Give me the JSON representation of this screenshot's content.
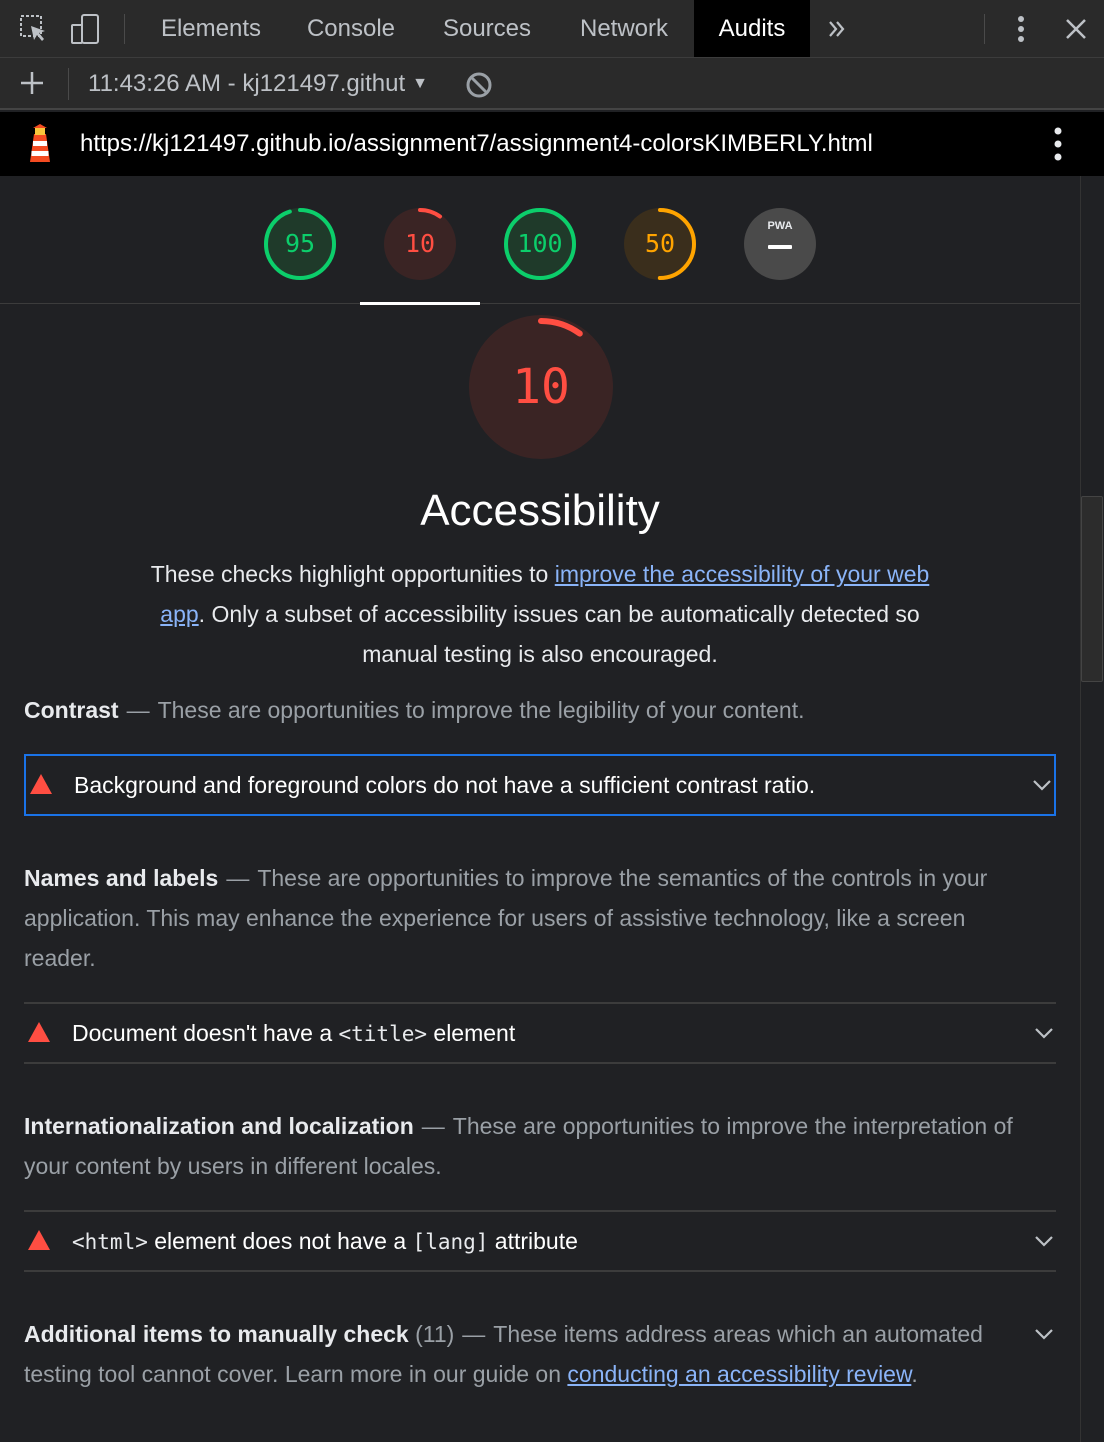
{
  "devtools": {
    "tabs": [
      {
        "label": "Elements"
      },
      {
        "label": "Console"
      },
      {
        "label": "Sources"
      },
      {
        "label": "Network"
      },
      {
        "label": "Audits",
        "active": true
      }
    ],
    "report_select": "11:43:26 AM - kj121497.githut",
    "url": "https://kj121497.github.io/assignment7/assignment4-colorsKIMBERLY.html"
  },
  "gauges": [
    {
      "score": "95",
      "fraction": 0.95,
      "color": "#0cce6b",
      "bg": "#1f3a2a"
    },
    {
      "score": "10",
      "fraction": 0.1,
      "color": "#ff4e42",
      "bg": "#3a2424",
      "selected": true
    },
    {
      "score": "100",
      "fraction": 1.0,
      "color": "#0cce6b",
      "bg": "#1f3a2a"
    },
    {
      "score": "50",
      "fraction": 0.5,
      "color": "#ffa400",
      "bg": "#3a2e1c"
    },
    {
      "score": "",
      "label": "PWA",
      "bg": "#4a4a4a"
    }
  ],
  "category": {
    "score": "10",
    "fraction": 0.1,
    "color": "#ff4e42",
    "title": "Accessibility",
    "desc_pre": "These checks highlight opportunities to ",
    "desc_link": "improve the accessibility of your web app",
    "desc_post": ". Only a subset of accessibility issues can be automatically detected so manual testing is also encouraged."
  },
  "groups": {
    "contrast": {
      "title": "Contrast",
      "desc": "These are opportunities to improve the legibility of your content.",
      "audit": "Background and foreground colors do not have a sufficient contrast ratio."
    },
    "names": {
      "title": "Names and labels",
      "desc": "These are opportunities to improve the semantics of the controls in your application. This may enhance the experience for users of assistive technology, like a screen reader.",
      "audit_pre": "Document doesn't have a ",
      "audit_code": "<title>",
      "audit_post": " element"
    },
    "i18n": {
      "title": "Internationalization and localization",
      "desc": "These are opportunities to improve the interpretation of your content by users in different locales.",
      "audit_code1": "<html>",
      "audit_mid": " element does not have a ",
      "audit_code2": "[lang]",
      "audit_post": " attribute"
    },
    "manual": {
      "title": "Additional items to manually check",
      "count": "(11)",
      "desc": "These items address areas which an automated testing tool cannot cover. Learn more in our guide on ",
      "link": "conducting an accessibility review",
      "post": "."
    }
  },
  "colors": {
    "fail": "#ff4e42",
    "pass": "#0cce6b",
    "average": "#ffa400",
    "link": "#8ab4f8",
    "focus": "#1a73e8"
  }
}
